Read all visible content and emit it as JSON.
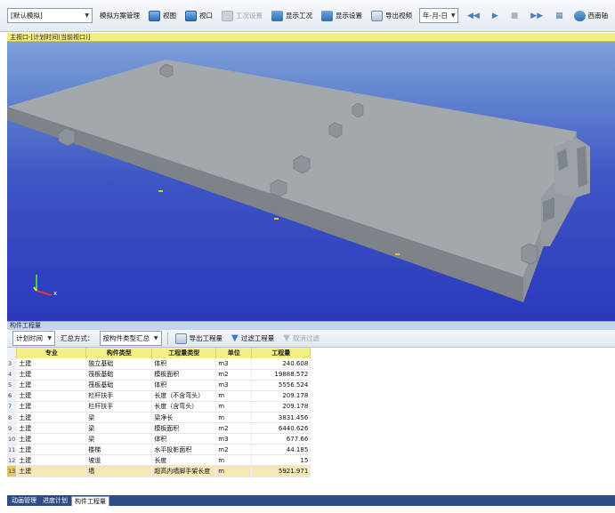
{
  "toolbar": {
    "scheme_select": "[默认模拟]",
    "items": [
      {
        "label": "模拟方案管理",
        "icon": "scheme-manage-icon",
        "enabled": true
      },
      {
        "label": "视图",
        "icon": "view-icon",
        "enabled": true
      },
      {
        "label": "视口",
        "icon": "viewport-icon",
        "enabled": true
      },
      {
        "label": "工况设置",
        "icon": "condition-settings-icon",
        "enabled": false
      },
      {
        "label": "显示工况",
        "icon": "show-condition-icon",
        "enabled": true
      },
      {
        "label": "显示设置",
        "icon": "display-settings-icon",
        "enabled": true
      },
      {
        "label": "导出视频",
        "icon": "export-video-icon",
        "enabled": true
      }
    ],
    "date_format_select": "年-月-日",
    "direction_label": "西南轴"
  },
  "viewport": {
    "title": "主视口-[计划时间(当前视口)]",
    "axis_x_label": "x"
  },
  "panel": {
    "title": "构件工程量",
    "time_select": "计划时间",
    "summary_label": "汇总方式：",
    "summary_select": "按构件类型汇总",
    "export_label": "导出工程量",
    "filter_label": "过滤工程量",
    "cancel_filter_label": "取消过滤"
  },
  "table": {
    "headers": [
      "专业",
      "构件类型",
      "工程量类型",
      "单位",
      "工程量"
    ],
    "rows": [
      {
        "no": "3",
        "spec": "土建",
        "type": "独立基础",
        "qty_type": "体积",
        "unit": "m3",
        "value": "240.608"
      },
      {
        "no": "4",
        "spec": "土建",
        "type": "筏板基础",
        "qty_type": "模板面积",
        "unit": "m2",
        "value": "19888.572"
      },
      {
        "no": "5",
        "spec": "土建",
        "type": "筏板基础",
        "qty_type": "体积",
        "unit": "m3",
        "value": "5556.524"
      },
      {
        "no": "6",
        "spec": "土建",
        "type": "栏杆扶手",
        "qty_type": "长度（不含弯头）",
        "unit": "m",
        "value": "209.178"
      },
      {
        "no": "7",
        "spec": "土建",
        "type": "栏杆扶手",
        "qty_type": "长度（含弯头）",
        "unit": "m",
        "value": "209.178"
      },
      {
        "no": "8",
        "spec": "土建",
        "type": "梁",
        "qty_type": "梁净长",
        "unit": "m",
        "value": "3831.456"
      },
      {
        "no": "9",
        "spec": "土建",
        "type": "梁",
        "qty_type": "模板面积",
        "unit": "m2",
        "value": "6440.626"
      },
      {
        "no": "10",
        "spec": "土建",
        "type": "梁",
        "qty_type": "体积",
        "unit": "m3",
        "value": "677.66"
      },
      {
        "no": "11",
        "spec": "土建",
        "type": "楼梯",
        "qty_type": "水平投影面积",
        "unit": "m2",
        "value": "44.185"
      },
      {
        "no": "12",
        "spec": "土建",
        "type": "坡道",
        "qty_type": "长度",
        "unit": "m",
        "value": "15"
      },
      {
        "no": "13",
        "spec": "土建",
        "type": "墙",
        "qty_type": "超高内墙脚手架长度",
        "unit": "m",
        "value": "5921.971"
      }
    ]
  },
  "tabs": [
    "动画管理",
    "进度计划",
    "构件工程量"
  ],
  "colors": {
    "sky_top": "#7ea0d9",
    "sky_bottom": "#2b38bc",
    "slab": "#9aa1a6",
    "header_yellow": "#f4ef86"
  }
}
